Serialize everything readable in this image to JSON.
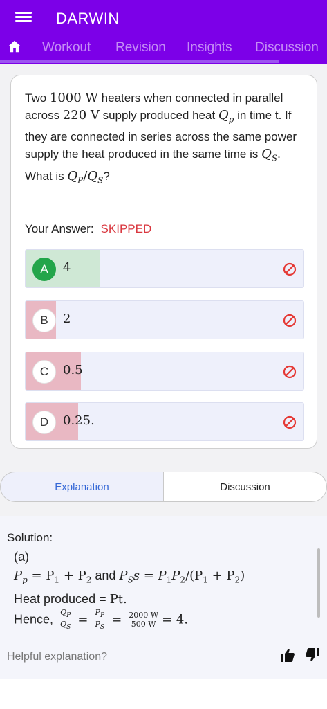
{
  "app": {
    "title": "DARWIN"
  },
  "tabs": [
    "Workout",
    "Revision",
    "Insights",
    "Discussion"
  ],
  "question": {
    "text_1": "Two ",
    "m1": "1000 W",
    "text_2": " heaters when connected in parallel across ",
    "m2": "220 V",
    "text_3": " supply produced heat ",
    "m3": "Q",
    "m3_sub": "p",
    "text_4": " in time t. If they are connected in series across the same power supply the heat produced in the same time is ",
    "m4": "Q",
    "m4_sub": "S",
    "text_5": ". What is ",
    "m5a": "Q",
    "m5a_sub": "P",
    "m5_slash": "/",
    "m5b": "Q",
    "m5b_sub": "S",
    "text_6": "?"
  },
  "answer": {
    "label": "Your Answer:",
    "status": "SKIPPED"
  },
  "options": [
    {
      "letter": "A",
      "value": "4",
      "correct": true
    },
    {
      "letter": "B",
      "value": "2",
      "correct": false
    },
    {
      "letter": "C",
      "value": "0.5",
      "correct": false
    },
    {
      "letter": "D",
      "value": "0.25.",
      "correct": false
    }
  ],
  "segment": {
    "explanation": "Explanation",
    "discussion": "Discussion"
  },
  "solution": {
    "title": "Solution:",
    "part": "(a)",
    "line1_a": "P",
    "line1_a_sub": "p",
    "line1_eq": " = P",
    "line1_sub1": "1",
    "line1_plus": " + P",
    "line1_sub2": "2",
    "line1_and": " and ",
    "line1_b": "P",
    "line1_b_sub": "S",
    "line1_b_tail": "s = P",
    "line1_s1": "1",
    "line1_p2": "P",
    "line1_s2": "2",
    "line1_div": "/(P",
    "line1_s3": "1",
    "line1_plus2": " + P",
    "line1_s4": "2",
    "line1_close": ")",
    "line2_text": "Heat produced = ",
    "line2_math": "Pt.",
    "line3_text": "Hence, ",
    "f1_num": "Q",
    "f1_num_sub": "P",
    "f1_den": "Q",
    "f1_den_sub": "S",
    "f2_num": "P",
    "f2_num_sub": "P",
    "f2_den": "P",
    "f2_den_sub": "S",
    "f3_num": "2000 W",
    "f3_den": "500 W",
    "eq": "=",
    "result": "= 4."
  },
  "feedback": {
    "label": "Helpful explanation?"
  },
  "colors": {
    "brand": "#7c00e8",
    "correct": "#23a54a",
    "wrong_fill": "#e9b8c3",
    "correct_fill": "#cfe8d5",
    "skipped": "#d9363e"
  }
}
